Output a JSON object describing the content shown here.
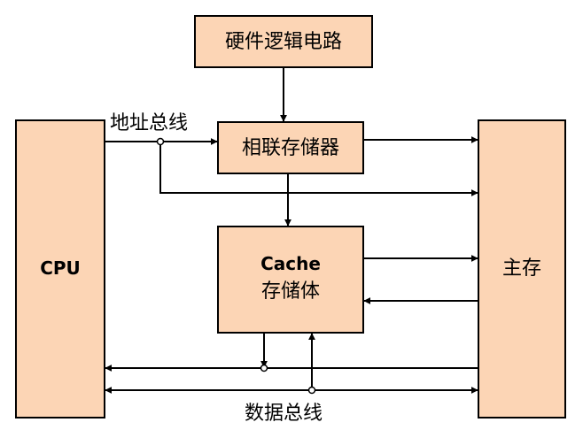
{
  "boxes": {
    "logic": "硬件逻辑电路",
    "assoc": "相联存储器",
    "cache_line1": "Cache",
    "cache_line2": "存储体",
    "cpu": "CPU",
    "main": "主存"
  },
  "bus_labels": {
    "address": "地址总线",
    "data": "数据总线"
  },
  "colors": {
    "box_fill": "#fcd5b5",
    "line": "#000000"
  }
}
